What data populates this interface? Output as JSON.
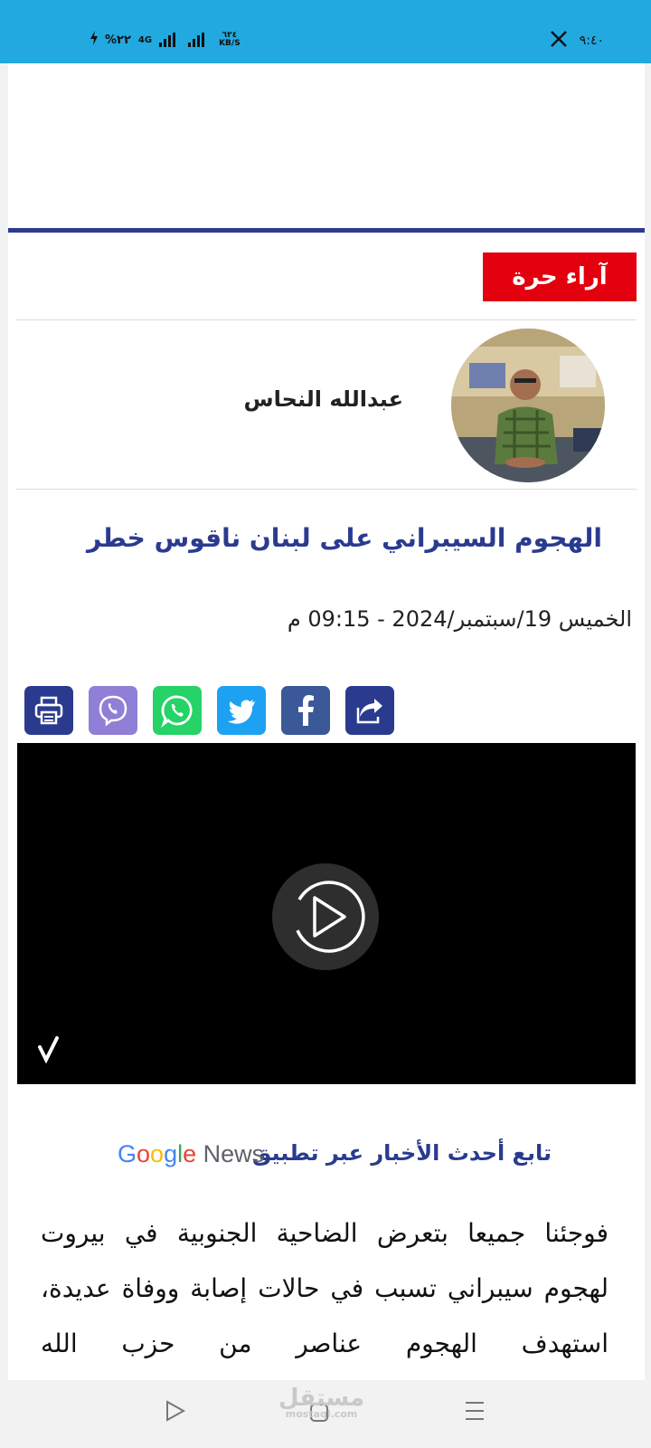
{
  "status_bar": {
    "time": "٩:٤٠",
    "battery": "%٢٢",
    "network": "4G",
    "speed_value": "٦٢٤",
    "speed_unit": "KB/S"
  },
  "section": {
    "badge_label": "آراء حرة"
  },
  "author": {
    "name": "عبدالله النحاس"
  },
  "article": {
    "title": "الهجوم السيبراني على لبنان ناقوس خطر",
    "date": "الخميس 19/سبتمبر/2024 - 09:15 م",
    "body": "فوجئنا جميعا بتعرض الضاحية الجنوبية في بيروت لهجوم سيبراني تسبب في حالات إصابة ووفاة عديدة، استهدف الهجوم عناصر من حزب الله"
  },
  "share": {
    "buttons": [
      {
        "icon": "share-icon",
        "color": "#2a3b8f"
      },
      {
        "icon": "facebook-icon",
        "color": "#3b5998"
      },
      {
        "icon": "twitter-icon",
        "color": "#1da1f2"
      },
      {
        "icon": "whatsapp-icon",
        "color": "#25d366"
      },
      {
        "icon": "viber-icon",
        "color": "#8f7fd6"
      },
      {
        "icon": "print-icon",
        "color": "#2a3b8f"
      }
    ]
  },
  "follow": {
    "text": "تابع أحدث الأخبار عبر تطبيق",
    "google_word": "Google",
    "news_word": "News"
  },
  "watermark": {
    "arabic": "مستقل",
    "latin": "mostaql.com"
  },
  "colors": {
    "status_bar": "#22a9e0",
    "accent_blue": "#2a3b8f",
    "badge_red": "#e3000f"
  }
}
